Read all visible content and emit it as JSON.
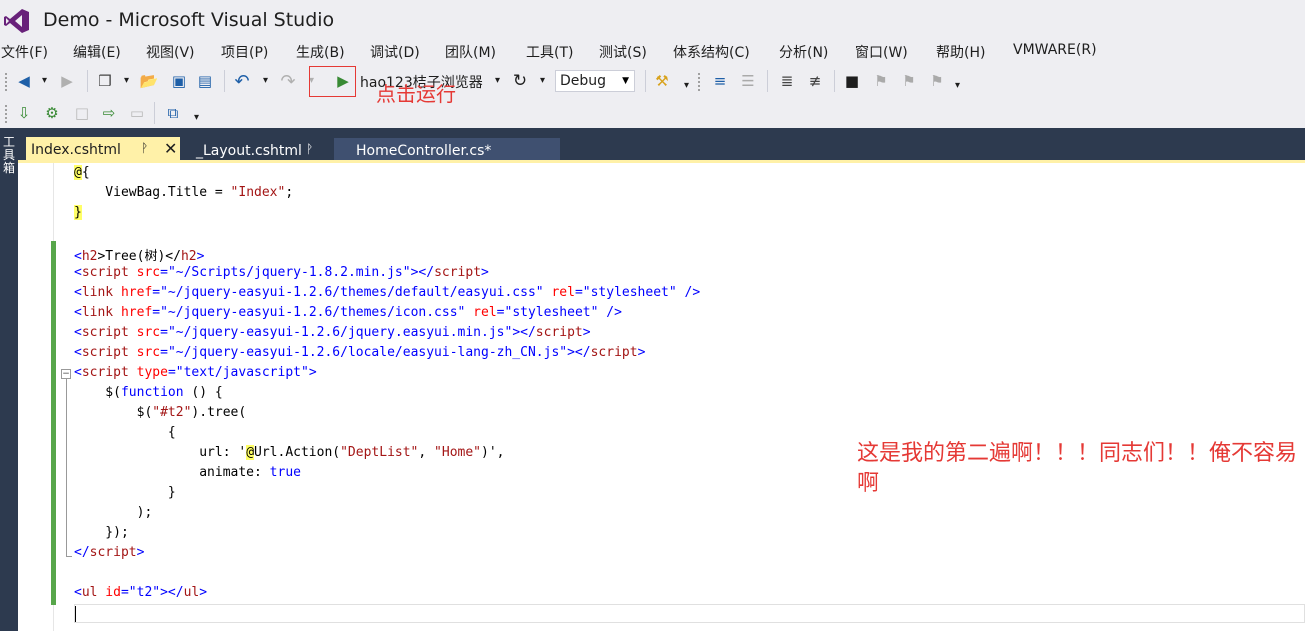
{
  "window": {
    "title": "Demo - Microsoft Visual Studio"
  },
  "menu": [
    "文件(F)",
    "编辑(E)",
    "视图(V)",
    "项目(P)",
    "生成(B)",
    "调试(D)",
    "团队(M)",
    "工具(T)",
    "测试(S)",
    "体系结构(C)",
    "分析(N)",
    "窗口(W)",
    "帮助(H)",
    "VMWARE(R)"
  ],
  "toolbar": {
    "browser": "hao123桔子浏览器",
    "configuration": "Debug",
    "annotation": "点击运行"
  },
  "sidebar": {
    "toolbox": "工具箱"
  },
  "tabs": [
    {
      "label": "Index.cshtml",
      "pin": "ᚹ",
      "close": "✕"
    },
    {
      "label": "_Layout.cshtml",
      "pin": "ᚹ"
    },
    {
      "label": "HomeController.cs*"
    }
  ],
  "code": {
    "l1a": "@",
    "l1b": "{",
    "l2a": "    ViewBag.Title = ",
    "l2b": "\"Index\"",
    "l2c": ";",
    "l3": "}",
    "l4a": "<",
    "l4b": "h2",
    "l4c": ">Tree(树)</",
    "l4d": "h2",
    "l4e": ">",
    "l5a": "<",
    "l5b": "script",
    "l5c": " src",
    "l5d": "=",
    "l5e": "\"~/Scripts/jquery-1.8.2.min.js\"",
    "l5f": "></",
    "l5g": "script",
    "l5h": ">",
    "l6a": "<",
    "l6b": "link",
    "l6c": " href",
    "l6d": "=",
    "l6e": "\"~/jquery-easyui-1.2.6/themes/default/easyui.css\"",
    "l6f": " rel",
    "l6g": "=",
    "l6h": "\"stylesheet\"",
    "l6i": " />",
    "l7a": "<",
    "l7b": "link",
    "l7c": " href",
    "l7d": "=",
    "l7e": "\"~/jquery-easyui-1.2.6/themes/icon.css\"",
    "l7f": " rel",
    "l7g": "=",
    "l7h": "\"stylesheet\"",
    "l7i": " />",
    "l8a": "<",
    "l8b": "script",
    "l8c": " src",
    "l8d": "=",
    "l8e": "\"~/jquery-easyui-1.2.6/jquery.easyui.min.js\"",
    "l8f": "></",
    "l8g": "script",
    "l8h": ">",
    "l9a": "<",
    "l9b": "script",
    "l9c": " src",
    "l9d": "=",
    "l9e": "\"~/jquery-easyui-1.2.6/locale/easyui-lang-zh_CN.js\"",
    "l9f": "></",
    "l9g": "script",
    "l9h": ">",
    "l10a": "<",
    "l10b": "script",
    "l10c": " type",
    "l10d": "=",
    "l10e": "\"text/javascript\"",
    "l10f": ">",
    "l11a": "    $(",
    "l11b": "function",
    "l11c": " () {",
    "l12a": "        $(",
    "l12b": "\"#t2\"",
    "l12c": ").tree(",
    "l13": "            {",
    "l14a": "                url: '",
    "l14b": "@",
    "l14c": "Url.Action(",
    "l14d": "\"DeptList\"",
    "l14e": ", ",
    "l14f": "\"Home\"",
    "l14g": ")',",
    "l15a": "                animate: ",
    "l15b": "true",
    "l16": "            }",
    "l17": "        );",
    "l18": "    });",
    "l19a": "</",
    "l19b": "script",
    "l19c": ">",
    "l20a": "<",
    "l20b": "ul",
    "l20c": " id",
    "l20d": "=",
    "l20e": "\"t2\"",
    "l20f": "></",
    "l20g": "ul",
    "l20h": ">"
  },
  "annotation_comment": "这是我的第二遍啊！！！同志们！！俺不容易啊",
  "colors": {
    "accent": "#68217a",
    "tab_active": "#fff1a8",
    "tabbar": "#2d3a4f",
    "annotation": "#e53935",
    "change_bar": "#57a64a"
  }
}
